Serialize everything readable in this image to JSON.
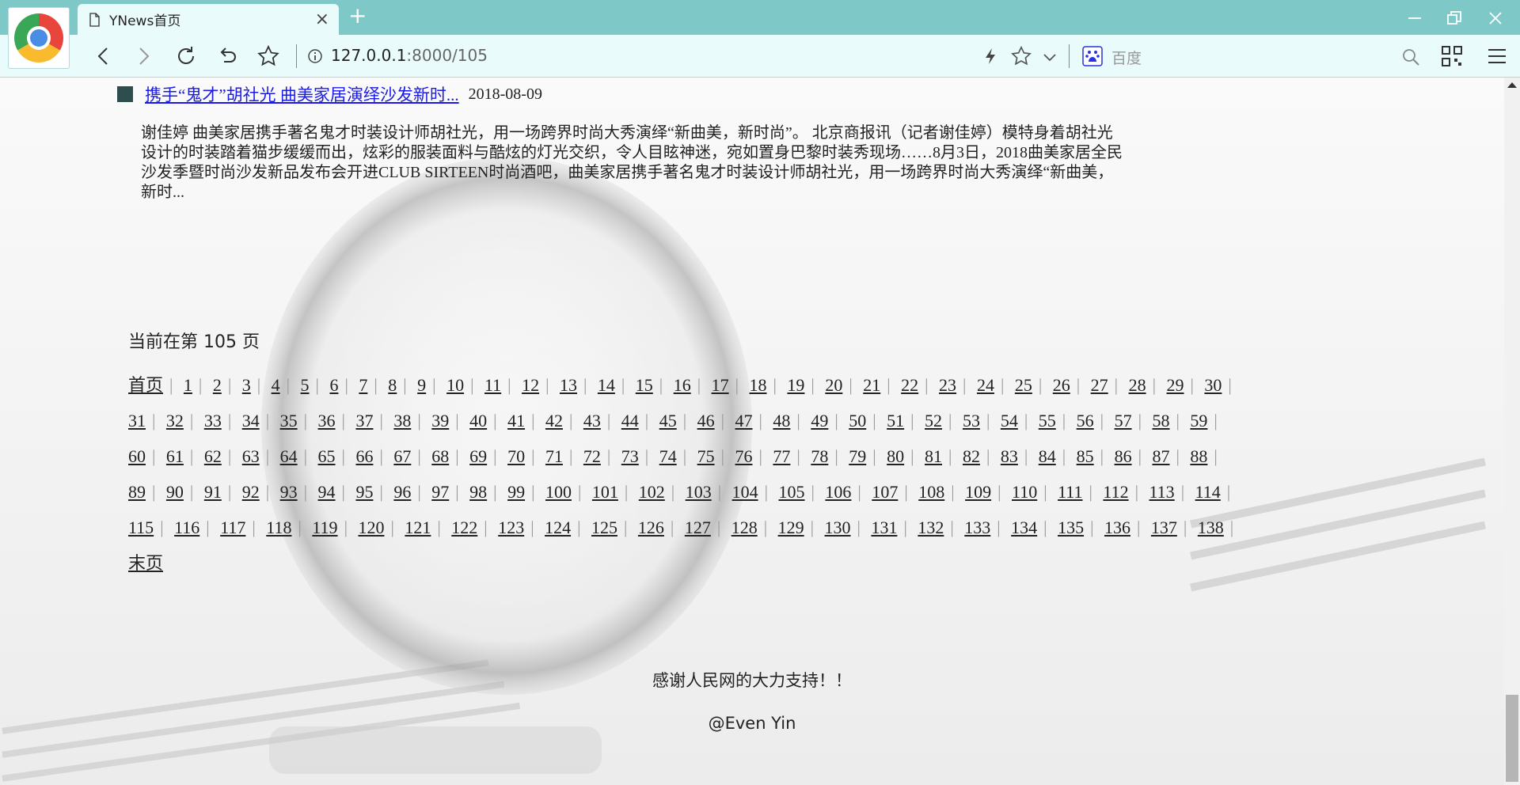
{
  "browser": {
    "tab_title": "YNews首页",
    "tab_close": "×",
    "new_tab": "+",
    "url_host": "127.0.0.1",
    "url_rest": ":8000/105",
    "search_engine_label": "百度",
    "icons": [
      "browser-logo-icon",
      "page-icon",
      "back-icon",
      "forward-icon",
      "reload-icon",
      "undo-icon",
      "bookmark-star-icon",
      "info-icon",
      "lightning-icon",
      "favorite-star-icon",
      "chevron-down-icon",
      "baidu-icon",
      "search-icon",
      "qr-code-icon",
      "menu-icon",
      "minimize-icon",
      "restore-icon",
      "close-icon"
    ]
  },
  "article": {
    "title": "携手“鬼才”胡社光 曲美家居演绎沙发新时...",
    "date": "2018-08-09",
    "body": "谢佳婷 曲美家居携手著名鬼才时装设计师胡社光，用一场跨界时尚大秀演绎“新曲美，新时尚”。 北京商报讯（记者谢佳婷）模特身着胡社光设计的时装踏着猫步缓缓而出，炫彩的服装面料与酷炫的灯光交织，令人目眩神迷，宛如置身巴黎时装秀现场……8月3日，2018曲美家居全民沙发季暨时尚沙发新品发布会开进CLUB SIRTEEN时尚酒吧，曲美家居携手著名鬼才时装设计师胡社光，用一场跨界时尚大秀演绎“新曲美，新时..."
  },
  "pagination": {
    "current_text": "当前在第 105 页",
    "first_label": "首页",
    "last_label": "末页",
    "separator": "|",
    "pages": [
      "1",
      "2",
      "3",
      "4",
      "5",
      "6",
      "7",
      "8",
      "9",
      "10",
      "11",
      "12",
      "13",
      "14",
      "15",
      "16",
      "17",
      "18",
      "19",
      "20",
      "21",
      "22",
      "23",
      "24",
      "25",
      "26",
      "27",
      "28",
      "29",
      "30",
      "31",
      "32",
      "33",
      "34",
      "35",
      "36",
      "37",
      "38",
      "39",
      "40",
      "41",
      "42",
      "43",
      "44",
      "45",
      "46",
      "47",
      "48",
      "49",
      "50",
      "51",
      "52",
      "53",
      "54",
      "55",
      "56",
      "57",
      "58",
      "59",
      "60",
      "61",
      "62",
      "63",
      "64",
      "65",
      "66",
      "67",
      "68",
      "69",
      "70",
      "71",
      "72",
      "73",
      "74",
      "75",
      "76",
      "77",
      "78",
      "79",
      "80",
      "81",
      "82",
      "83",
      "84",
      "85",
      "86",
      "87",
      "88",
      "89",
      "90",
      "91",
      "92",
      "93",
      "94",
      "95",
      "96",
      "97",
      "98",
      "99",
      "100",
      "101",
      "102",
      "103",
      "104",
      "105",
      "106",
      "107",
      "108",
      "109",
      "110",
      "111",
      "112",
      "113",
      "114",
      "115",
      "116",
      "117",
      "118",
      "119",
      "120",
      "121",
      "122",
      "123",
      "124",
      "125",
      "126",
      "127",
      "128",
      "129",
      "130",
      "131",
      "132",
      "133",
      "134",
      "135",
      "136",
      "137",
      "138"
    ]
  },
  "footer": {
    "thanks": "感谢人民网的大力支持！！",
    "author": "@Even Yin"
  },
  "colors": {
    "chrome": "#7fc8c8",
    "toolbar": "#e9fbfb",
    "link": "#1a1ae6",
    "square": "#2e4e4e"
  }
}
